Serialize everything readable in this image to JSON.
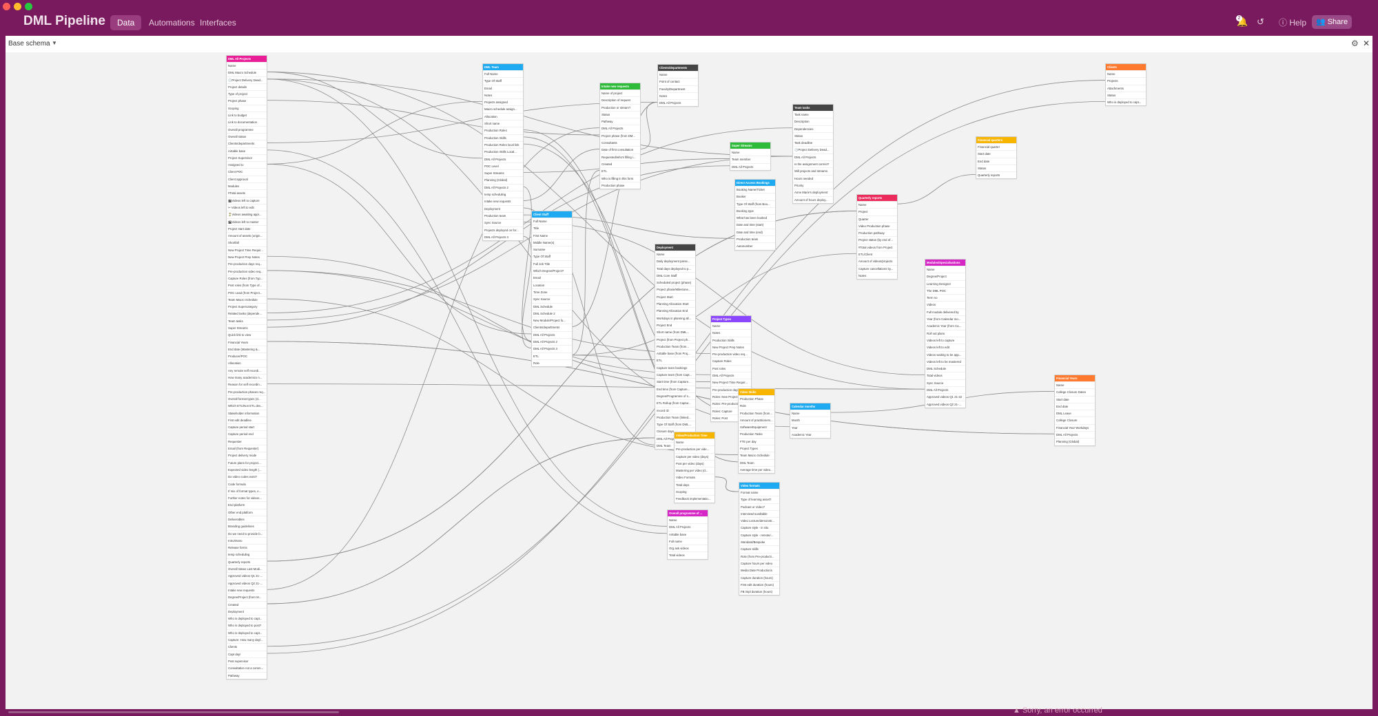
{
  "app": {
    "name": "DML Pipeline",
    "tabs": [
      "Data",
      "Automations",
      "Interfaces"
    ],
    "active_tab": "Data",
    "notification_count": "2",
    "help_label": "Help",
    "share_label": "Share"
  },
  "schema": {
    "title": "Base schema"
  },
  "error_message": "Sorry, an error occurred",
  "colors": {
    "brand": "#7a1a5e",
    "pink": "#e91e97",
    "blue": "#1eaaf1",
    "dark": "#444444",
    "green": "#2fbb3a",
    "orange": "#ff7a2e",
    "yellow": "#f7b500",
    "red": "#ec2b5d",
    "purple": "#8b46ff",
    "magenta": "#d726c6"
  },
  "tables": [
    {
      "name": "DML All Projects",
      "color": "pink",
      "fields": [
        "Name",
        "DML Macro Schedule",
        "🕓Project Delivery Dead...",
        "Project details",
        "Type of project",
        "Project phase",
        "Scoping",
        "Link to budget",
        "Link to documentation",
        "Overall programme",
        "Overall status",
        "Clients/departments",
        "Airtable base",
        "Project Supervisor",
        "Assigned to",
        "Client POC",
        "Client approval",
        "Modules",
        "#Total assets",
        "🎬Videos left to capture",
        "✂ Videos left to edit",
        "⏳Videos awaiting appr...",
        "🎬Videos left to master",
        "Project start date",
        "Amount of assets (origin...",
        "Shortfall",
        "New Project Time Requir...",
        "New Project Prep Notes",
        "Pre-production days req...",
        "Pre-production video req...",
        "Capture Roles (from Typ...",
        "Post roles (from Type of...",
        "POC Lead (from Project...",
        "Team Macro Schedule",
        "Project Supercategory",
        "Related tasks (depende...",
        "Team tasks",
        "Super Streams",
        "Quick link to view",
        "Financial Years",
        "End date (Mastering &...",
        "Producer/POC",
        "Allocation",
        "Any remote self recordi...",
        "How many academics n...",
        "Reason for self recordin...",
        "Pre-production phases req...",
        "Overall format types (cl...",
        "Which ETL/Non ETL dev...",
        "Stakeholder information",
        "First edit deadline",
        "Capture period start",
        "Capture period end",
        "Requester",
        "Email (from Requester)",
        "Project delivery mode",
        "Future plans for project...",
        "Expected video length (...",
        "Do video codes exist?",
        "Code formula",
        "If mix of format types, e...",
        "Further notes for videos...",
        "End platform",
        "Other end platform",
        "Deliverables",
        "Branding guidelines",
        "Do we need to provide b...",
        "Intro/Outro",
        "Release forms",
        "temp scheduling",
        "Quarterly reports",
        "Overall status Last Modi...",
        "Approved videos Q1 21-...",
        "Approved videos Q2 21-...",
        "Intake new requests",
        "Degree/Project (from M...",
        "Created",
        "Deployment",
        "Who is deployed to capt...",
        "Who is deployed to post?",
        "Who is deployed to capt...",
        "Capture: How many dayl...",
        "Clients",
        "Capt day!",
        "Post supervisor",
        "Consultation not a comm...",
        "Pathway"
      ]
    },
    {
      "name": "DML Team",
      "color": "blue",
      "fields": [
        "Full Name",
        "Type Of Staff",
        "Email",
        "Notes",
        "Projects assigned",
        "Macro schedule assign...",
        "Allocation",
        "Short name",
        "Production Roles",
        "Production Skills",
        "Production Roles local link",
        "Production Skills Local...",
        "DML All Projects",
        "POC Level",
        "Super Streams",
        "Planning (Global)",
        "DML All Projects 2",
        "temp scheduling",
        "Intake new requests",
        "Deployment",
        "Production team",
        "Sync Source",
        "Projects deployed on for...",
        "DML All Projects 3"
      ]
    },
    {
      "name": "Clients/departments",
      "color": "dark",
      "fields": [
        "Name",
        "Point of contact",
        "Faculty/Department",
        "Notes",
        "DML All Projects"
      ]
    },
    {
      "name": "Intake new requests",
      "color": "green",
      "fields": [
        "Name of project",
        "Description of request",
        "Production or stream?",
        "Status",
        "Pathway",
        "DML All Projects",
        "Project phase (from DM...",
        "Consultants",
        "Date of first consultation",
        "Requested/who's filling i...",
        "Created",
        "ETL",
        "Who is filling in this form",
        "Production phase"
      ]
    },
    {
      "name": "Clients",
      "color": "orange",
      "fields": [
        "Name",
        "Projects",
        "Attachments",
        "Status",
        "Who is deployed to capt..."
      ]
    },
    {
      "name": "Team tasks",
      "color": "dark",
      "fields": [
        "Task name",
        "Description",
        "Dependencies",
        "Status",
        "Task deadline",
        "🕓Project Delivery Dead...",
        "DML All Projects",
        "Is the assignment correct?",
        "Will projects and streams",
        "Hours needed",
        "Priority",
        "Anne Marie's deployment",
        "Amount of hours deploy..."
      ]
    },
    {
      "name": "Super Streams",
      "color": "green",
      "fields": [
        "Name",
        "Team member",
        "DML All Projects"
      ]
    },
    {
      "name": "Financial quarters",
      "color": "yellow",
      "fields": [
        "Financial quarter",
        "Start date",
        "End date",
        "Status",
        "Quarterly reports"
      ]
    },
    {
      "name": "Direct Access Bookings",
      "color": "blue",
      "fields": [
        "Booking Name/Ticket",
        "Booker",
        "Type Of Staff (from Boo...",
        "Booking type",
        "What has been booked",
        "Date and time (start)",
        "Date and time (end)",
        "Production team",
        "Autonumber"
      ]
    },
    {
      "name": "Quarterly reports",
      "color": "red",
      "fields": [
        "Name",
        "Project",
        "Quarter",
        "Video Production phase",
        "Production pathway",
        "Project status (by end of...",
        "#Total videos from Project",
        "ETL/Client",
        "Amount of videos/projects",
        "Capture cancellations by...",
        "Notes"
      ]
    },
    {
      "name": "Client Staff",
      "color": "blue",
      "fields": [
        "Full Name",
        "Title",
        "First Name",
        "Middle Name(s)",
        "Surname",
        "Type Of Staff",
        "Full Job Title",
        "Which Degree/Project?",
        "Email",
        "Location",
        "Time Zone",
        "Sync Source",
        "DML Schedule",
        "DML Schedule 2",
        "New Module/Project fo...",
        "Clients/departments",
        "DML All Projects",
        "DML All Projects 2",
        "DML All Projects 3",
        "ETL",
        "Role"
      ]
    },
    {
      "name": "Deployment",
      "color": "dark",
      "fields": [
        "Name",
        "Daily deployment parse...",
        "Total days deployed to p...",
        "DML Core Staff",
        "Scheduled project (phase)",
        "Project phase/Milestone...",
        "Project Start",
        "Planning Allocation Start",
        "Planning Allocation End",
        "Workdays in planning all...",
        "Project End",
        "Short name (from DML...",
        "Project (from Project ph...",
        "Production Team (from...",
        "Airtable base (from Proj...",
        "ETL",
        "Capture team bookings",
        "Capture team (from Capt...",
        "Start time (from Capture...",
        "End time (from Capture...",
        "Degree/Programme of s...",
        "ETL Rollup (from Captur...",
        "record ID",
        "Production Team (linked...",
        "Type Of Staff (from DML...",
        "Closure days",
        "DML All Projects",
        "DML Team"
      ]
    },
    {
      "name": "Modules/Specialisations",
      "color": "magenta",
      "fields": [
        "Name",
        "Degree/Project",
        "Learning Designer",
        "The DML POC",
        "Term no",
        "Videos",
        "Full module delivered by",
        "Year (from Calendar mo...",
        "Academic Year (from Ca...",
        "Roll out plans",
        "Videos left to capture",
        "Videos left to edit",
        "Videos waiting to be app...",
        "Videos left to be mastered",
        "DML Schedule",
        "Total videos",
        "Sync Source",
        "DML All Projects",
        "Approved videos Q1 21-22",
        "Approved videos Q2 21-..."
      ]
    },
    {
      "name": "Project Types",
      "color": "purple",
      "fields": [
        "Name",
        "Notes",
        "Production Skills",
        "New Project Prep Notes",
        "Pre-production video req...",
        "Capture Roles",
        "Post roles",
        "DML All Projects",
        "New Project Time Requir...",
        "Pre-production days req...",
        "Roles: New Project Prep",
        "Roles: Pre-production",
        "Roles: Capture",
        "Roles: Post"
      ]
    },
    {
      "name": "Video Skills",
      "color": "yellow",
      "fields": [
        "Production Phase",
        "Role",
        "Production Team (from...",
        "Amount of practitioners...",
        "Software/Equipment",
        "Production Tasks",
        "FTE per day",
        "Project Types",
        "Team Macro Schedule",
        "DML Team",
        "Average time per video..."
      ]
    },
    {
      "name": "Calendar months",
      "color": "blue",
      "fields": [
        "Name",
        "Month",
        "Year",
        "Academic Year"
      ]
    },
    {
      "name": "Financial Years",
      "color": "orange",
      "fields": [
        "Name",
        "College Closure Dates",
        "Start date",
        "End date",
        "DML Leave",
        "College Closure",
        "Financial Year Workdays",
        "DML All Projects",
        "Planning (Global)"
      ]
    },
    {
      "name": "Video/Production Time",
      "color": "yellow",
      "fields": [
        "Name",
        "Pre-production per vide...",
        "Capture per video (days)",
        "Post per video (days)",
        "Mastering per video (d...",
        "Video Formats",
        "Total days",
        "Scoping",
        "Feedback implementatio..."
      ]
    },
    {
      "name": "Overall programme of ...",
      "color": "magenta",
      "fields": [
        "Name",
        "DML All Projects",
        "Airtable base",
        "Full name",
        "Org ask videos",
        "Total videos"
      ]
    },
    {
      "name": "Video formats",
      "color": "blue",
      "fields": [
        "Format name",
        "Type of learning asset?",
        "Podcast or Video?",
        "Interview/roundtable",
        "Video Lecture/demonstr...",
        "Capture style - in situ",
        "Capture style - remote/...",
        "Standard/Bespoke",
        "Capture skills",
        "Role (from Pre-producti...",
        "Capture hours per video",
        "Media Date Productions",
        "Capture duration (hours)",
        "First edit duration (hours)",
        "FB impl duration (hours)"
      ]
    }
  ]
}
